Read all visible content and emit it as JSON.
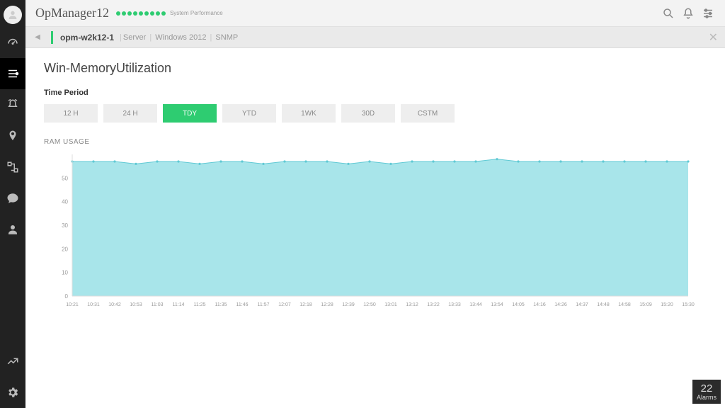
{
  "header": {
    "brand": "OpManager12",
    "perf_label": "System Performance",
    "perf_dots": 9
  },
  "breadcrumb": {
    "host": "opm-w2k12-1",
    "type": "Server",
    "os": "Windows 2012",
    "protocol": "SNMP"
  },
  "page": {
    "title": "Win-MemoryUtilization",
    "period_label": "Time Period",
    "periods": [
      "12 H",
      "24 H",
      "TDY",
      "YTD",
      "1WK",
      "30D",
      "CSTM"
    ],
    "period_active_index": 2,
    "chart_label": "RAM USAGE"
  },
  "alarms": {
    "count": "22",
    "label": "Alarms"
  },
  "chart_data": {
    "type": "area",
    "title": "RAM USAGE",
    "ylabel": "",
    "xlabel": "",
    "ylim": [
      0,
      60
    ],
    "yticks": [
      0,
      10,
      20,
      30,
      40,
      50
    ],
    "categories": [
      "10:21",
      "10:31",
      "10:42",
      "10:53",
      "11:03",
      "11:14",
      "11:25",
      "11:35",
      "11:46",
      "11:57",
      "12:07",
      "12:18",
      "12:28",
      "12:39",
      "12:50",
      "13:01",
      "13:12",
      "13:22",
      "13:33",
      "13:44",
      "13:54",
      "14:05",
      "14:16",
      "14:26",
      "14:37",
      "14:48",
      "14:58",
      "15:09",
      "15:20",
      "15:30"
    ],
    "series": [
      {
        "name": "RAM",
        "color": "#9fe2e8",
        "values": [
          57,
          57,
          57,
          56,
          57,
          57,
          56,
          57,
          57,
          56,
          57,
          57,
          57,
          56,
          57,
          56,
          57,
          57,
          57,
          57,
          58,
          57,
          57,
          57,
          57,
          57,
          57,
          57,
          57,
          57
        ]
      }
    ]
  }
}
